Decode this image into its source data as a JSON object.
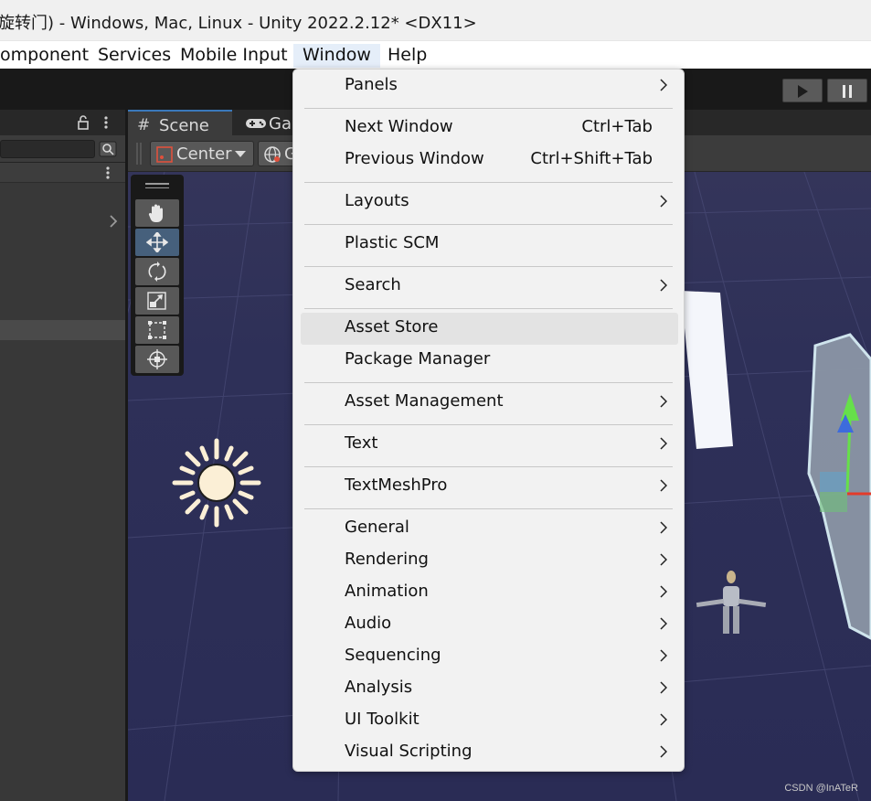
{
  "window": {
    "title": "旋转门) - Windows, Mac, Linux - Unity 2022.2.12* <DX11>"
  },
  "menubar": {
    "items": [
      {
        "label": "omponent"
      },
      {
        "label": "Services"
      },
      {
        "label": "Mobile Input"
      },
      {
        "label": "Window"
      },
      {
        "label": "Help"
      }
    ],
    "active": "Window"
  },
  "scene_tabs": {
    "scene": "Scene",
    "game": "Ga"
  },
  "scene_toolbar": {
    "pivot": "Center",
    "global": "G"
  },
  "window_menu": {
    "items": [
      {
        "label": "Panels",
        "shortcut": "",
        "submenu": true
      },
      {
        "label": "Next Window",
        "shortcut": "Ctrl+Tab",
        "submenu": false
      },
      {
        "label": "Previous Window",
        "shortcut": "Ctrl+Shift+Tab",
        "submenu": false
      },
      {
        "label": "Layouts",
        "shortcut": "",
        "submenu": true
      },
      {
        "label": "Plastic SCM",
        "shortcut": "",
        "submenu": false
      },
      {
        "label": "Search",
        "shortcut": "",
        "submenu": true
      },
      {
        "label": "Asset Store",
        "shortcut": "",
        "submenu": false,
        "hovered": true
      },
      {
        "label": "Package Manager",
        "shortcut": "",
        "submenu": false
      },
      {
        "label": "Asset Management",
        "shortcut": "",
        "submenu": true
      },
      {
        "label": "Text",
        "shortcut": "",
        "submenu": true
      },
      {
        "label": "TextMeshPro",
        "shortcut": "",
        "submenu": true
      },
      {
        "label": "General",
        "shortcut": "",
        "submenu": true
      },
      {
        "label": "Rendering",
        "shortcut": "",
        "submenu": true
      },
      {
        "label": "Animation",
        "shortcut": "",
        "submenu": true
      },
      {
        "label": "Audio",
        "shortcut": "",
        "submenu": true
      },
      {
        "label": "Sequencing",
        "shortcut": "",
        "submenu": true
      },
      {
        "label": "Analysis",
        "shortcut": "",
        "submenu": true
      },
      {
        "label": "UI Toolkit",
        "shortcut": "",
        "submenu": true
      },
      {
        "label": "Visual Scripting",
        "shortcut": "",
        "submenu": true
      }
    ]
  },
  "watermark": "CSDN @InATeR",
  "colors": {
    "accent": "#3a79bb",
    "menu_bg": "#f2f2f2",
    "menu_hover": "#e3e3e3",
    "toolbar_bg": "#191919",
    "scene_sky": "#2e3058"
  }
}
